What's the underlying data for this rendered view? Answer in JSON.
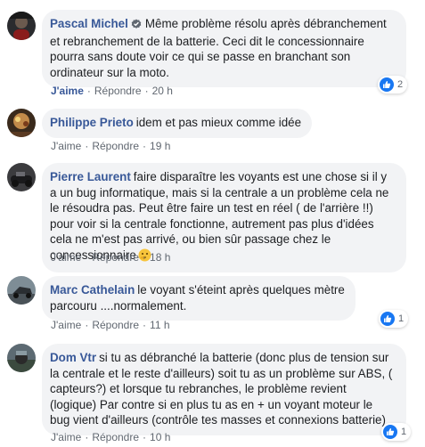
{
  "comments": [
    {
      "author": "Pascal Michel",
      "verified": true,
      "text": "Même problème résolu après débranchement et rebranchement de la batterie. Ceci dit le concessionnaire pourra sans doute voir ce qui se passe en branchant son ordinateur sur la moto.",
      "like_label": "J'aime",
      "like_active": true,
      "reply_label": "Répondre",
      "time": "20 h",
      "reaction_count": "2"
    },
    {
      "author": "Philippe Prieto",
      "text": "idem et pas mieux comme idée",
      "like_label": "J'aime",
      "reply_label": "Répondre",
      "time": "19 h"
    },
    {
      "author": "Pierre Laurent",
      "text": "faire disparaître les voyants est une chose si il y a un bug informatique, mais si la centrale a un problème cela ne le résoudra pas. Peut être faire un test en réel ( de l'arrière !!) pour voir si la centrale fonctionne, autrement pas plus d'idées cela ne m'est pas arrivé, ou bien sûr passage chez le concessionnaire",
      "emoji": "thinking-face-emoji",
      "like_label": "J'aime",
      "reply_label": "Répondre",
      "time": "18 h"
    },
    {
      "author": "Marc Cathelain",
      "text": "le voyant s'éteint après quelques mètre parcouru ....normalement.",
      "like_label": "J'aime",
      "reply_label": "Répondre",
      "time": "11 h",
      "reaction_count": "1"
    },
    {
      "author": "Dom Vtr",
      "text": "si tu as débranché la batterie (donc plus de tension sur la centrale et le reste d'ailleurs) soit tu as un problème sur ABS, ( capteurs?) et lorsque tu rebranches, le problème revient (logique) Par contre si en plus tu as en + un voyant moteur le bug vient d'ailleurs (contrôle tes masses et connexions batterie)",
      "like_label": "J'aime",
      "reply_label": "Répondre",
      "time": "10 h",
      "reaction_count": "1"
    }
  ],
  "colors": {
    "author": "#385898",
    "bubble": "#f2f3f5",
    "meta": "#606770",
    "like_badge": "#1877f2"
  }
}
